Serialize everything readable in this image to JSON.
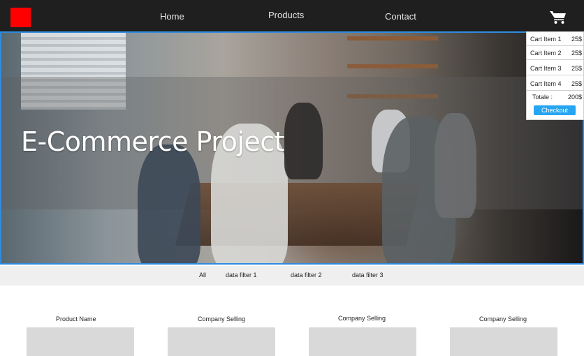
{
  "nav": {
    "links": [
      "Home",
      "Products",
      "Contact"
    ],
    "logo_color": "#ff0000",
    "cart_icon": "cart-icon"
  },
  "hero": {
    "title": "E-Commerce Project"
  },
  "cart": {
    "items": [
      {
        "name": "Cart Item 1",
        "price": "25$"
      },
      {
        "name": "Cart Item 2",
        "price": "25$"
      },
      {
        "name": "Cart Item 3",
        "price": "25$"
      },
      {
        "name": "Cart Item 4",
        "price": "25$"
      }
    ],
    "total_label": "Totale :",
    "total_amount": "200$",
    "checkout_label": "Checkout"
  },
  "filters": [
    "All",
    "data filter 1",
    "data filter 2",
    "data filter 3"
  ],
  "products": [
    {
      "label": "Product Name"
    },
    {
      "label": "Company Selling"
    },
    {
      "label": "Company Selling"
    },
    {
      "label": "Company Selling"
    }
  ],
  "colors": {
    "nav_bg": "#1f1f1f",
    "accent_border": "#2f8be0",
    "checkout_bg": "#26a6f2",
    "placeholder": "#d9d9d9"
  }
}
